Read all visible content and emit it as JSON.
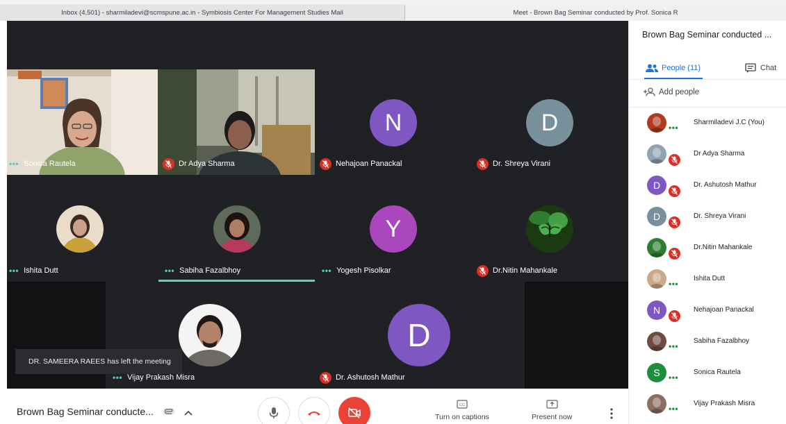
{
  "browser": {
    "tab1_title": "Inbox (4,501) - sharmiladevi@scmspune.ac.in - Symbiosis Center For Management Studies Mail",
    "tab2_title": "Meet - Brown Bag Seminar conducted by Prof. Sonica R"
  },
  "tiles": [
    {
      "name": "Sonica Rautela",
      "status": "speaking",
      "kind": "video"
    },
    {
      "name": "Dr Adya Sharma",
      "status": "muted",
      "kind": "video"
    },
    {
      "name": "Nehajoan Panackal",
      "status": "muted",
      "kind": "letter",
      "letter": "N",
      "color": "#7e57c2"
    },
    {
      "name": "Dr. Shreya Virani",
      "status": "muted",
      "kind": "letter",
      "letter": "D",
      "color": "#78909c"
    },
    {
      "name": "Ishita Dutt",
      "status": "speaking",
      "kind": "photo"
    },
    {
      "name": "Sabiha Fazalbhoy",
      "status": "speaking",
      "kind": "photo"
    },
    {
      "name": "Yogesh Pisolkar",
      "status": "speaking",
      "kind": "letter",
      "letter": "Y",
      "color": "#ab47bc"
    },
    {
      "name": "Dr.Nitin Mahankale",
      "status": "muted",
      "kind": "photo"
    },
    {
      "name": "Vijay Prakash Misra",
      "status": "speaking",
      "kind": "photo"
    },
    {
      "name": "Dr. Ashutosh Mathur",
      "status": "muted",
      "kind": "letter",
      "letter": "D",
      "color": "#7e57c2"
    }
  ],
  "toast": "DR. SAMEERA RAEES has left the meeting",
  "bottombar": {
    "meeting_title": "Brown Bag Seminar conducte...",
    "captions_label": "Turn on captions",
    "present_label": "Present now"
  },
  "panel": {
    "title": "Brown Bag Seminar conducted ...",
    "people_tab": "People (11)",
    "chat_tab": "Chat",
    "add_people": "Add people",
    "participants": [
      {
        "name": "Sharmiladevi J.C (You)",
        "status": "speaking",
        "kind": "photo",
        "color": "#b23a1e"
      },
      {
        "name": "Dr Adya Sharma",
        "status": "muted",
        "kind": "photo",
        "color": "#8fa3b0"
      },
      {
        "name": "Dr. Ashutosh Mathur",
        "status": "muted",
        "kind": "letter",
        "letter": "D",
        "color": "#7e57c2"
      },
      {
        "name": "Dr. Shreya Virani",
        "status": "muted",
        "kind": "letter",
        "letter": "D",
        "color": "#78909c"
      },
      {
        "name": "Dr.Nitin Mahankale",
        "status": "muted",
        "kind": "photo",
        "color": "#2e7d32"
      },
      {
        "name": "Ishita Dutt",
        "status": "speaking",
        "kind": "photo",
        "color": "#c9a98a"
      },
      {
        "name": "Nehajoan Panackal",
        "status": "muted",
        "kind": "letter",
        "letter": "N",
        "color": "#7e57c2"
      },
      {
        "name": "Sabiha Fazalbhoy",
        "status": "speaking",
        "kind": "photo",
        "color": "#6d4c41"
      },
      {
        "name": "Sonica Rautela",
        "status": "speaking",
        "kind": "letter",
        "letter": "S",
        "color": "#1e8e3e"
      },
      {
        "name": "Vijay Prakash Misra",
        "status": "speaking",
        "kind": "photo",
        "color": "#8d6e63"
      }
    ]
  },
  "colors": {
    "accent": "#1a73e8",
    "muted_red": "#d93025",
    "end_call_red": "#ea4335",
    "stage_bg": "#202124",
    "speaking_green": "#1e8e3e"
  }
}
